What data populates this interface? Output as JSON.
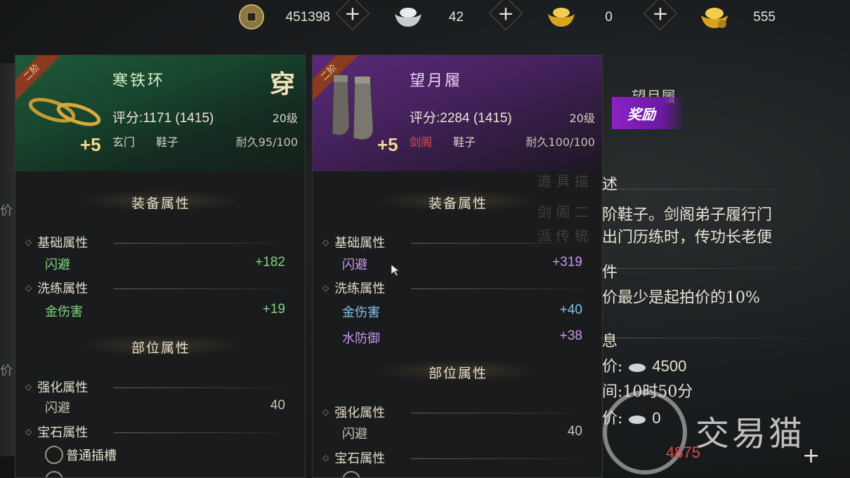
{
  "currencies": [
    {
      "icon": "copper-coin-icon",
      "value": "451398"
    },
    {
      "icon": "silver-ingot-icon",
      "value": "42"
    },
    {
      "icon": "gold-ingot-icon",
      "value": "0"
    },
    {
      "icon": "gold-bag-icon",
      "value": "555"
    }
  ],
  "add_label": "+",
  "left_item": {
    "tier": "二阶",
    "name": "寒铁环",
    "wear_badge": "穿",
    "score": "评分:1171 (1415)",
    "level": "20级",
    "enhance": "+5",
    "faction": "玄门",
    "slot": "鞋子",
    "durability": "耐久95/100",
    "section_equip": "装备属性",
    "basic_title": "基础属性",
    "basic": [
      {
        "name": "闪避",
        "value": "+182"
      }
    ],
    "refine_title": "洗练属性",
    "refine": [
      {
        "name": "金伤害",
        "value": "+19"
      }
    ],
    "section_part": "部位属性",
    "strengthen_title": "强化属性",
    "strengthen": [
      {
        "name": "闪避",
        "value": "40"
      }
    ],
    "gem_title": "宝石属性",
    "socket_label": "普通插槽"
  },
  "right_item": {
    "tier": "二阶",
    "name": "望月履",
    "score": "评分:2284 (1415)",
    "level": "20级",
    "enhance": "+5",
    "faction": "剑阁",
    "slot": "鞋子",
    "durability": "耐久100/100",
    "section_equip": "装备属性",
    "basic_title": "基础属性",
    "basic": [
      {
        "name": "闪避",
        "value": "+319"
      }
    ],
    "refine_title": "洗练属性",
    "refine": [
      {
        "name": "金伤害",
        "value": "+40"
      },
      {
        "name": "水防御",
        "value": "+38"
      }
    ],
    "section_part": "部位属性",
    "strengthen_title": "强化属性",
    "strengthen": [
      {
        "name": "闪避",
        "value": "40"
      }
    ],
    "gem_title": "宝石属性"
  },
  "detail": {
    "title": "望月履",
    "reward": "奖励",
    "desc_header": "述",
    "desc_line1": "阶鞋子。剑阁弟子履行门",
    "desc_line2": "出门历练时，传功长老便",
    "cond_header": "件",
    "cond_text": "价最少是起拍价的10%",
    "info_header": "息",
    "price_label": "价:",
    "price_value": "4500",
    "time_text": "间:10时50分",
    "my_bid_label": "价:",
    "my_bid_value": "0",
    "bid_price": "4875"
  },
  "watermark": "交易猫",
  "bg_labels": {
    "left1": "价",
    "left2": "价"
  }
}
